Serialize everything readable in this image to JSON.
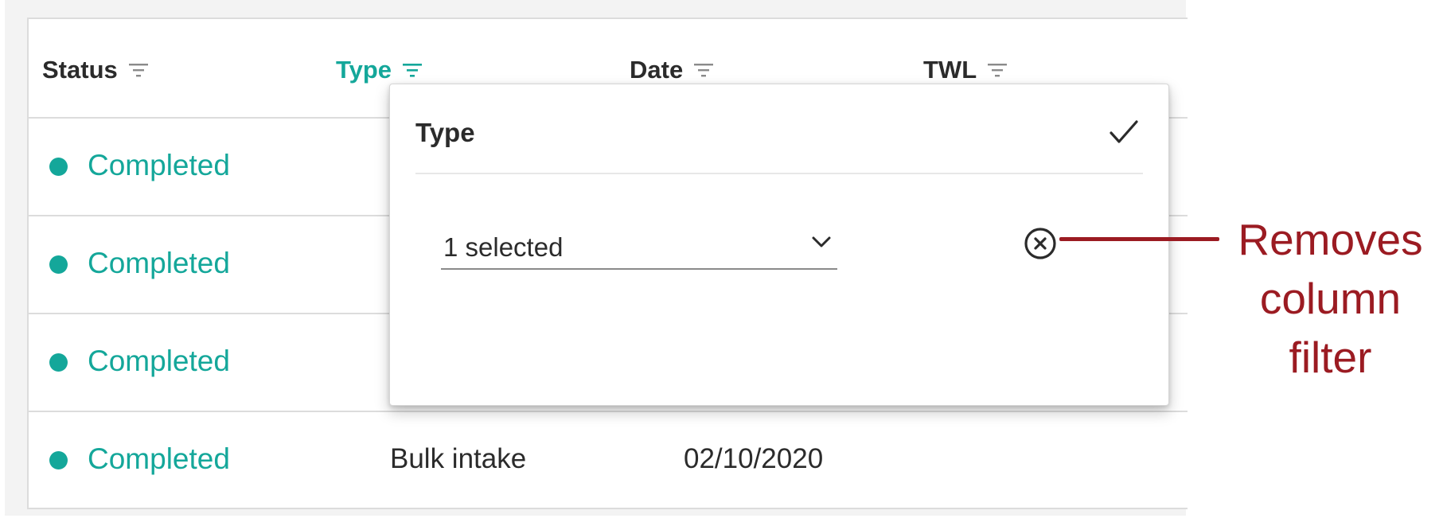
{
  "table": {
    "columns": [
      {
        "label": "Status",
        "icon": "filter-icon",
        "active": false
      },
      {
        "label": "Type",
        "icon": "filter-icon",
        "active": true
      },
      {
        "label": "Date",
        "icon": "filter-icon",
        "active": false
      },
      {
        "label": "TWL",
        "icon": "filter-icon",
        "active": false
      }
    ],
    "rows": [
      {
        "status": "Completed",
        "type": "",
        "date": ""
      },
      {
        "status": "Completed",
        "type": "",
        "date": ""
      },
      {
        "status": "Completed",
        "type": "",
        "date": ""
      },
      {
        "status": "Completed",
        "type": "Bulk intake",
        "date": "02/10/2020"
      }
    ]
  },
  "filter_popup": {
    "title": "Type",
    "apply_icon": "check-icon",
    "select_value": "1 selected",
    "select_icon": "chevron-down-icon",
    "clear_icon": "close-circle-icon"
  },
  "annotation": {
    "lines": [
      "Removes",
      "column",
      "filter"
    ]
  },
  "colors": {
    "accent": "#14a79a",
    "annotation": "#9b1b22",
    "text": "#2b2b2b",
    "border": "#dcdcdc"
  }
}
